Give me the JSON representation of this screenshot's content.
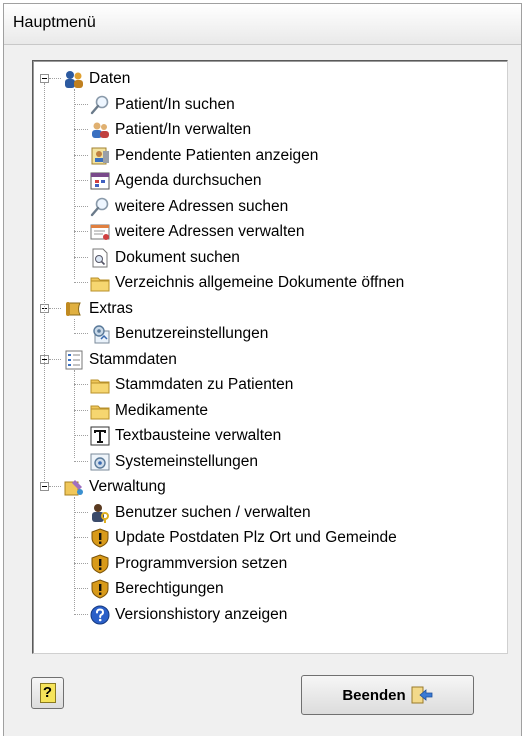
{
  "window": {
    "title": "Hauptmenü"
  },
  "tree": {
    "groups": [
      {
        "label": "Daten",
        "icon": "people-data-icon",
        "items": [
          {
            "label": "Patient/In suchen",
            "icon": "magnifier-icon"
          },
          {
            "label": "Patient/In verwalten",
            "icon": "users-icon"
          },
          {
            "label": "Pendente Patienten anzeigen",
            "icon": "pending-patient-icon"
          },
          {
            "label": "Agenda durchsuchen",
            "icon": "calendar-icon"
          },
          {
            "label": "weitere Adressen suchen",
            "icon": "magnifier-icon"
          },
          {
            "label": "weitere Adressen verwalten",
            "icon": "address-card-icon"
          },
          {
            "label": "Dokument suchen",
            "icon": "document-search-icon"
          },
          {
            "label": "Verzeichnis allgemeine Dokumente öffnen",
            "icon": "folder-icon"
          }
        ]
      },
      {
        "label": "Extras",
        "icon": "scroll-icon",
        "items": [
          {
            "label": "Benutzereinstellungen",
            "icon": "settings-gear-icon"
          }
        ]
      },
      {
        "label": "Stammdaten",
        "icon": "list-icon",
        "items": [
          {
            "label": "Stammdaten zu Patienten",
            "icon": "folder-icon"
          },
          {
            "label": "Medikamente",
            "icon": "folder-icon"
          },
          {
            "label": "Textbausteine verwalten",
            "icon": "text-t-icon"
          },
          {
            "label": "Systemeinstellungen",
            "icon": "system-settings-icon"
          }
        ]
      },
      {
        "label": "Verwaltung",
        "icon": "admin-tools-icon",
        "items": [
          {
            "label": "Benutzer suchen / verwalten",
            "icon": "user-key-icon"
          },
          {
            "label": "Update Postdaten Plz Ort und Gemeinde",
            "icon": "shield-warning-icon"
          },
          {
            "label": "Programmversion setzen",
            "icon": "shield-warning-icon"
          },
          {
            "label": "Berechtigungen",
            "icon": "shield-warning-icon"
          },
          {
            "label": "Versionshistory anzeigen",
            "icon": "help-circle-icon"
          }
        ]
      }
    ]
  },
  "buttons": {
    "help_glyph": "?",
    "quit_label": "Beenden"
  },
  "colors": {
    "folder": "#f0c75a",
    "shield": "#d89a1a",
    "help": "#2a5fc8",
    "quit_arrow": "#3a7bd5"
  }
}
